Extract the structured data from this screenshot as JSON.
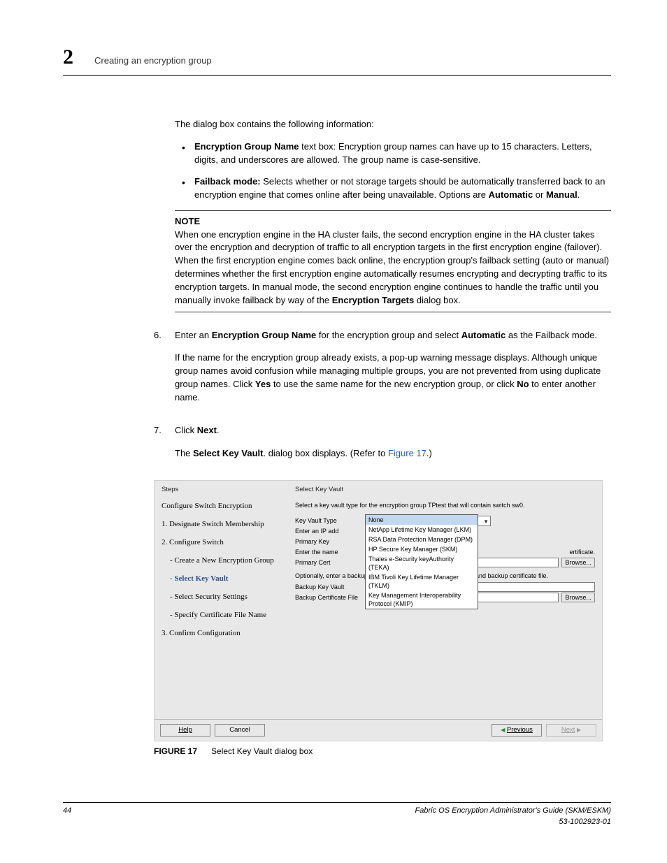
{
  "header": {
    "chapter_num": "2",
    "title": "Creating an encryption group"
  },
  "intro": "The dialog box contains the following information:",
  "bullets": {
    "b1_strong": "Encryption Group Name",
    "b1_rest": " text box: Encryption group names can have up to 15 characters. Letters, digits, and underscores are allowed. The group name is case-sensitive.",
    "b2_strong": "Failback mode:",
    "b2_rest": " Selects whether or not storage targets should be automatically transferred back to an encryption engine that comes online after being unavailable. Options are ",
    "b2_auto": "Automatic",
    "b2_or": " or ",
    "b2_manual": "Manual",
    "b2_end": "."
  },
  "note": {
    "label": "NOTE",
    "body_pre": "When one encryption engine in the HA cluster fails, the second encryption engine in the HA cluster takes over the encryption and decryption of traffic to all encryption targets in the first encryption engine (failover). When the first encryption engine comes back online, the encryption group's failback setting (auto or manual) determines whether the first encryption engine automatically resumes encrypting and decrypting traffic to its encryption targets. In manual mode, the second encryption engine continues to handle the traffic until you manually invoke failback by way of the ",
    "body_strong": "Encryption Targets",
    "body_post": " dialog box."
  },
  "step6": {
    "num": "6.",
    "line1_pre": "Enter an ",
    "line1_s1": "Encryption Group Name",
    "line1_mid": " for the encryption group and select ",
    "line1_s2": "Automatic",
    "line1_post": " as the Failback mode.",
    "para2_pre": "If the name for the encryption group already exists, a pop-up warning message displays. Although unique group names avoid confusion while managing multiple groups, you are not prevented from using duplicate group names. Click ",
    "para2_yes": "Yes",
    "para2_mid": " to use the same name for the new encryption group, or click ",
    "para2_no": "No",
    "para2_post": " to enter another name."
  },
  "step7": {
    "num": "7.",
    "pre": "Click ",
    "strong": "Next",
    "post": ".",
    "result_pre": "The ",
    "result_strong": "Select Key Vault",
    "result_mid": ". dialog box displays. (Refer to ",
    "result_link": "Figure 17",
    "result_post": ".)"
  },
  "dialog": {
    "steps_title": "Steps",
    "right_title": "Select Key Vault",
    "hint1": "Select a key vault type for the encryption group TPtest that will contain switch sw0.",
    "step_root": "Configure Switch Encryption",
    "step_1": "1. Designate Switch Membership",
    "step_2": "2. Configure Switch",
    "step_2a": "- Create a New Encryption Group",
    "step_2b": "- Select Key Vault",
    "step_2c": "- Select Security Settings",
    "step_2d": "- Specify Certificate File Name",
    "step_3": "3. Confirm Configuration",
    "labels": {
      "type": "Key Vault Type",
      "ip": "Enter an IP add",
      "primary_kv": "Primary Key",
      "name": "Enter the name",
      "primary_cert": "Primary Cert",
      "backup_kv": "Backup Key Vault",
      "backup_cert": "Backup Certificate File"
    },
    "cert_tail": "ertificate.",
    "select_value": "None",
    "dropdown": {
      "o0": "None",
      "o1": "NetApp Lifetime Key Manager (LKM)",
      "o2": "RSA Data Protection Manager (DPM)",
      "o3": "HP Secure Key Manager (SKM)",
      "o4": "Thales e-Security keyAuthority (TEKA)",
      "o5": "IBM Tivoli Key Lifetime Manager (TKLM)",
      "o6": "Key Management Interoperability Protocol (KMIP)"
    },
    "hint2": "Optionally, enter a backup key vault address (IPv4 or hostname) and backup certificate file.",
    "browse": "Browse...",
    "btn_help": "Help",
    "btn_cancel": "Cancel",
    "btn_prev": "Previous",
    "btn_next": "Next"
  },
  "figcap": {
    "label": "FIGURE 17",
    "text": "Select Key Vault dialog box"
  },
  "footer": {
    "page": "44",
    "doc": "Fabric OS Encryption Administrator's Guide (SKM/ESKM)",
    "num": "53-1002923-01"
  }
}
